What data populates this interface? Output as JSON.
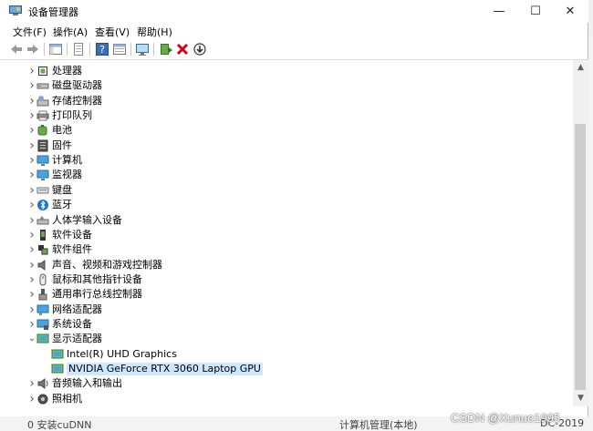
{
  "window": {
    "title": "设备管理器",
    "controls": {
      "minimize": "—",
      "maximize": "☐",
      "close": "✕"
    }
  },
  "menu": [
    "文件(F)",
    "操作(A)",
    "查看(V)",
    "帮助(H)"
  ],
  "devices": [
    {
      "label": "处理器",
      "icon": "cpu-icon",
      "expanded": false,
      "level": 0
    },
    {
      "label": "磁盘驱动器",
      "icon": "disk-icon",
      "expanded": false,
      "level": 0
    },
    {
      "label": "存储控制器",
      "icon": "storage-icon",
      "expanded": false,
      "level": 0
    },
    {
      "label": "打印队列",
      "icon": "printer-icon",
      "expanded": false,
      "level": 0
    },
    {
      "label": "电池",
      "icon": "battery-icon",
      "expanded": false,
      "level": 0
    },
    {
      "label": "固件",
      "icon": "firmware-icon",
      "expanded": false,
      "level": 0
    },
    {
      "label": "计算机",
      "icon": "computer-icon",
      "expanded": false,
      "level": 0
    },
    {
      "label": "监视器",
      "icon": "monitor-icon",
      "expanded": false,
      "level": 0
    },
    {
      "label": "键盘",
      "icon": "keyboard-icon",
      "expanded": false,
      "level": 0
    },
    {
      "label": "蓝牙",
      "icon": "bluetooth-icon",
      "expanded": false,
      "level": 0
    },
    {
      "label": "人体学输入设备",
      "icon": "hid-icon",
      "expanded": false,
      "level": 0
    },
    {
      "label": "软件设备",
      "icon": "software-device-icon",
      "expanded": false,
      "level": 0
    },
    {
      "label": "软件组件",
      "icon": "software-component-icon",
      "expanded": false,
      "level": 0
    },
    {
      "label": "声音、视频和游戏控制器",
      "icon": "speaker-icon",
      "expanded": false,
      "level": 0
    },
    {
      "label": "鼠标和其他指针设备",
      "icon": "mouse-icon",
      "expanded": false,
      "level": 0
    },
    {
      "label": "通用串行总线控制器",
      "icon": "usb-icon",
      "expanded": false,
      "level": 0
    },
    {
      "label": "网络适配器",
      "icon": "network-icon",
      "expanded": false,
      "level": 0
    },
    {
      "label": "系统设备",
      "icon": "system-device-icon",
      "expanded": false,
      "level": 0
    },
    {
      "label": "显示适配器",
      "icon": "display-adapter-icon",
      "expanded": true,
      "level": 0
    },
    {
      "label": "Intel(R) UHD Graphics",
      "icon": "display-adapter-icon",
      "level": 1
    },
    {
      "label": "NVIDIA GeForce RTX 3060 Laptop GPU",
      "icon": "display-adapter-icon",
      "level": 1,
      "selected": true
    },
    {
      "label": "音频输入和输出",
      "icon": "audio-io-icon",
      "expanded": false,
      "level": 0
    },
    {
      "label": "照相机",
      "icon": "camera-icon",
      "expanded": false,
      "level": 0
    }
  ],
  "background": {
    "left_fragment": "0 安装cuDNN",
    "right_fragment_1": "计算机管理(本地)",
    "right_fragment_2": "DC-2019"
  },
  "watermark": "CSDN @Xunuo1995",
  "colors": {
    "selection": "#cce8ff",
    "accent": "#0078d7"
  }
}
